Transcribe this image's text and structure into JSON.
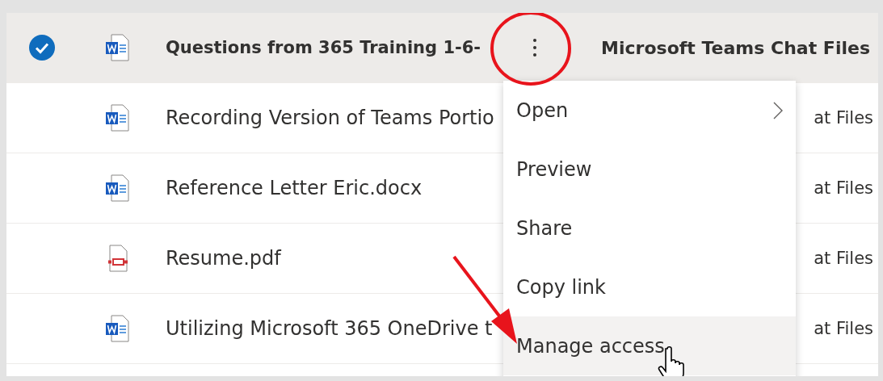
{
  "rows": [
    {
      "selected": true,
      "kind": "word",
      "name": "Questions from 365 Training 1-6-",
      "location": "Microsoft Teams Chat Files"
    },
    {
      "selected": false,
      "kind": "word",
      "name": "Recording Version of Teams Portio",
      "location": "at Files"
    },
    {
      "selected": false,
      "kind": "word",
      "name": "Reference Letter Eric.docx",
      "location": "at Files"
    },
    {
      "selected": false,
      "kind": "pdf",
      "name": "Resume.pdf",
      "location": "at Files"
    },
    {
      "selected": false,
      "kind": "word",
      "name": "Utilizing Microsoft 365 OneDrive t",
      "location": "at Files"
    }
  ],
  "context_menu": {
    "items": [
      {
        "label": "Open",
        "has_submenu": true,
        "highlighted": false
      },
      {
        "label": "Preview",
        "has_submenu": false,
        "highlighted": false
      },
      {
        "label": "Share",
        "has_submenu": false,
        "highlighted": false
      },
      {
        "label": "Copy link",
        "has_submenu": false,
        "highlighted": false
      },
      {
        "label": "Manage access",
        "has_submenu": false,
        "highlighted": true
      }
    ]
  }
}
